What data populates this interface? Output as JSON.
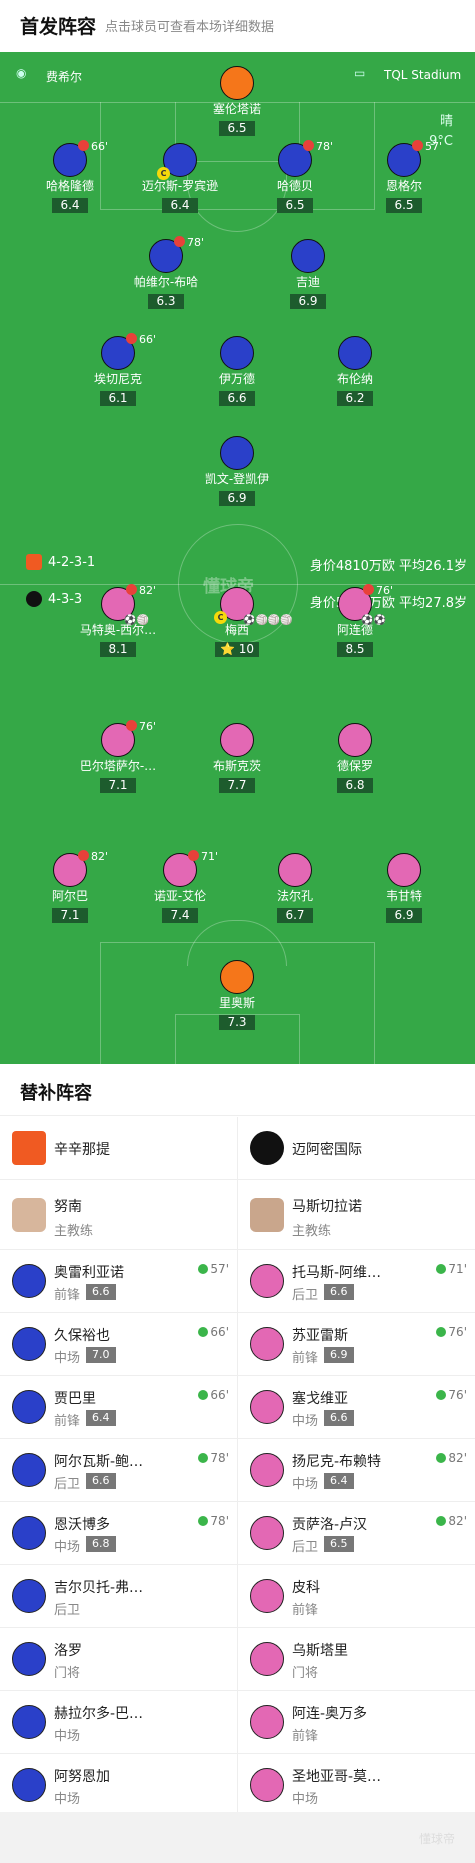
{
  "header": {
    "title": "首发阵容",
    "subtitle": "点击球员可查看本场详细数据"
  },
  "venue": {
    "home": "费希尔",
    "stadium": "TQL Stadium",
    "weather": "晴",
    "temp": "9°C"
  },
  "watermark": "懂球帝",
  "home_team": {
    "formation": "4-2-3-1",
    "value_text": "身价4810万欧 平均26.1岁",
    "color": "#2a40c9",
    "players": [
      {
        "name": "塞伦塔诺",
        "rating": "6.5",
        "gk": true
      },
      {
        "name": "哈格隆德",
        "rating": "6.4",
        "sub": "66'"
      },
      {
        "name": "迈尔斯-罗宾逊",
        "rating": "6.4",
        "captain": true
      },
      {
        "name": "哈德贝",
        "rating": "6.5",
        "sub": "78'"
      },
      {
        "name": "恩格尔",
        "rating": "6.5",
        "sub": "57'"
      },
      {
        "name": "帕维尔-布哈",
        "rating": "6.3",
        "sub": "78'"
      },
      {
        "name": "吉迪",
        "rating": "6.9"
      },
      {
        "name": "埃切尼克",
        "rating": "6.1",
        "sub": "66'"
      },
      {
        "name": "伊万德",
        "rating": "6.6"
      },
      {
        "name": "布伦纳",
        "rating": "6.2"
      },
      {
        "name": "凯文-登凯伊",
        "rating": "6.9"
      }
    ]
  },
  "away_team": {
    "formation": "4-3-3",
    "value_text": "身价5900万欧 平均27.8岁",
    "color": "#e368b4",
    "players": [
      {
        "name": "马特奥-西尔…",
        "rating": "8.1",
        "sub": "82'",
        "balls": "⚽🏐"
      },
      {
        "name": "梅西",
        "rating": "10",
        "captain": true,
        "balls": "⚽🏐🏐🏐",
        "star": true
      },
      {
        "name": "阿连德",
        "rating": "8.5",
        "sub": "76'",
        "balls": "⚽⚽"
      },
      {
        "name": "巴尔塔萨尔-…",
        "rating": "7.1",
        "sub": "76'"
      },
      {
        "name": "布斯克茨",
        "rating": "7.7"
      },
      {
        "name": "德保罗",
        "rating": "6.8"
      },
      {
        "name": "阿尔巴",
        "rating": "7.1",
        "sub": "82'"
      },
      {
        "name": "诺亚-艾伦",
        "rating": "7.4",
        "sub": "71'"
      },
      {
        "name": "法尔孔",
        "rating": "6.7"
      },
      {
        "name": "韦甘特",
        "rating": "6.9"
      },
      {
        "name": "里奥斯",
        "rating": "7.3",
        "gk": true
      }
    ]
  },
  "subs_title": "替补阵容",
  "subs_home": {
    "team": "辛辛那提",
    "coach": "努南",
    "coach_role": "主教练",
    "players": [
      {
        "name": "奥雷利亚诺",
        "pos": "前锋",
        "rating": "6.6",
        "min": "57'"
      },
      {
        "name": "久保裕也",
        "pos": "中场",
        "rating": "7.0",
        "min": "66'"
      },
      {
        "name": "贾巴里",
        "pos": "前锋",
        "rating": "6.4",
        "min": "66'"
      },
      {
        "name": "阿尔瓦斯-鲍…",
        "pos": "后卫",
        "rating": "6.6",
        "min": "78'"
      },
      {
        "name": "恩沃博多",
        "pos": "中场",
        "rating": "6.8",
        "min": "78'"
      },
      {
        "name": "吉尔贝托-弗…",
        "pos": "后卫"
      },
      {
        "name": "洛罗",
        "pos": "门将"
      },
      {
        "name": "赫拉尔多-巴…",
        "pos": "中场"
      },
      {
        "name": "阿努恩加",
        "pos": "中场"
      }
    ]
  },
  "subs_away": {
    "team": "迈阿密国际",
    "coach": "马斯切拉诺",
    "coach_role": "主教练",
    "players": [
      {
        "name": "托马斯-阿维…",
        "pos": "后卫",
        "rating": "6.6",
        "min": "71'"
      },
      {
        "name": "苏亚雷斯",
        "pos": "前锋",
        "rating": "6.9",
        "min": "76'"
      },
      {
        "name": "塞戈维亚",
        "pos": "中场",
        "rating": "6.6",
        "min": "76'"
      },
      {
        "name": "扬尼克-布赖特",
        "pos": "中场",
        "rating": "6.4",
        "min": "82'"
      },
      {
        "name": "贡萨洛-卢汉",
        "pos": "后卫",
        "rating": "6.5",
        "min": "82'"
      },
      {
        "name": "皮科",
        "pos": "前锋"
      },
      {
        "name": "乌斯塔里",
        "pos": "门将"
      },
      {
        "name": "阿连-奥万多",
        "pos": "前锋"
      },
      {
        "name": "圣地亚哥-莫…",
        "pos": "中场"
      }
    ]
  },
  "footer_watermark": "懂球帝"
}
